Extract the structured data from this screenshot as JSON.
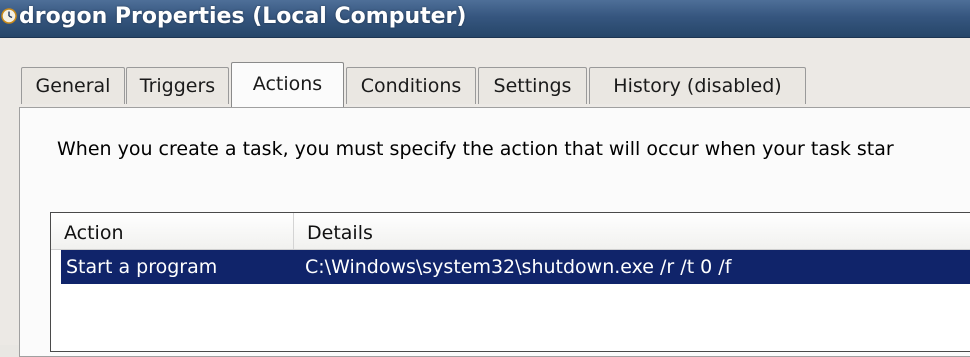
{
  "window": {
    "title": "drogon Properties (Local Computer)"
  },
  "tabs": [
    {
      "label": "General",
      "active": false
    },
    {
      "label": "Triggers",
      "active": false
    },
    {
      "label": "Actions",
      "active": true
    },
    {
      "label": "Conditions",
      "active": false
    },
    {
      "label": "Settings",
      "active": false
    },
    {
      "label": "History (disabled)",
      "active": false
    }
  ],
  "actions_panel": {
    "description": "When you create a task, you must specify the action that will occur when your task star",
    "columns": [
      "Action",
      "Details"
    ],
    "rows": [
      {
        "action": "Start a program",
        "details": "C:\\Windows\\system32\\shutdown.exe /r /t 0 /f",
        "selected": true
      }
    ]
  },
  "colors": {
    "titlebar": "#36567f",
    "selection": "#10246a",
    "dialog_bg": "#ece9e5"
  },
  "icons": {
    "window_icon": "task-scheduler-clock-icon"
  }
}
